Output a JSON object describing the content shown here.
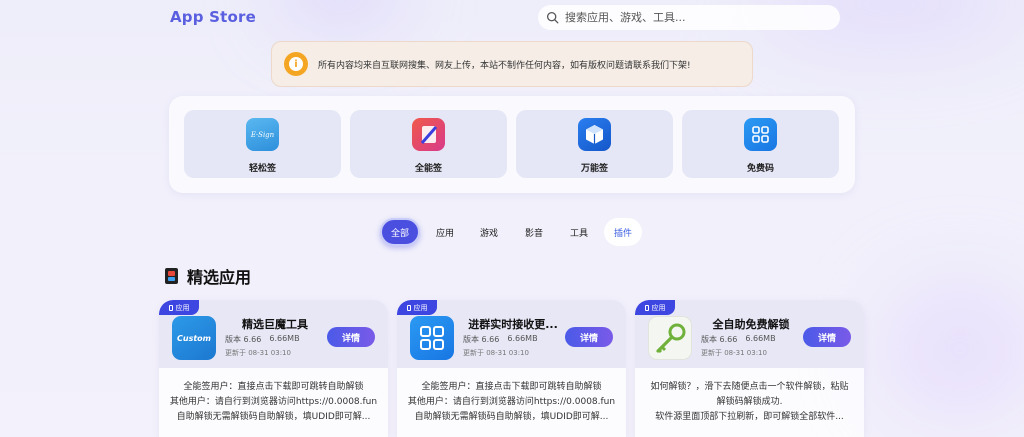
{
  "header": {
    "brand": "App Store",
    "search_placeholder": "搜索应用、游戏、工具..."
  },
  "notice": {
    "icon": "info-icon",
    "text": "所有内容均来自互联网搜集、网友上传，本站不制作任何内容，如有版权问题请联系我们下架!"
  },
  "featured": [
    {
      "label": "轻松签",
      "icon": "esign-icon",
      "icon_text": "E·Sign"
    },
    {
      "label": "全能签",
      "icon": "pen-icon"
    },
    {
      "label": "万能签",
      "icon": "box-icon"
    },
    {
      "label": "免费码",
      "icon": "grid-icon"
    }
  ],
  "tabs": [
    {
      "label": "全部",
      "active": true
    },
    {
      "label": "应用"
    },
    {
      "label": "游戏"
    },
    {
      "label": "影音"
    },
    {
      "label": "工具"
    },
    {
      "label": "插件"
    }
  ],
  "section": {
    "title": "精选应用"
  },
  "apps": [
    {
      "badge": "应用",
      "name": "精选巨魔工具",
      "version": "版本 6.66",
      "size": "6.66MB",
      "updated": "更新于 08-31 03:10",
      "button": "详情",
      "icon_text": "Custom",
      "description": "全能签用户：直接点击下载即可跳转自助解锁\n其他用户：请自行到浏览器访问https://0.0008.fun\n自助解锁无需解锁码自助解锁，填UDID即可解..."
    },
    {
      "badge": "应用",
      "name": "进群实时接收更...",
      "version": "版本 6.66",
      "size": "6.66MB",
      "updated": "更新于 08-31 03:10",
      "button": "详情",
      "description": "全能签用户：直接点击下载即可跳转自助解锁\n其他用户：请自行到浏览器访问https://0.0008.fun\n自助解锁无需解锁码自助解锁，填UDID即可解..."
    },
    {
      "badge": "应用",
      "name": "全自助免费解锁",
      "version": "版本 6.66",
      "size": "6.66MB",
      "updated": "更新于 08-31 03:10",
      "button": "详情",
      "description": "如何解锁？，滑下去随便点击一个软件解锁，粘贴\n解锁码解锁成功.\n软件源里面顶部下拉刷新，即可解锁全部软件..."
    }
  ],
  "colors": {
    "accent": "#4b4fe0",
    "brand": "#5a5fe0",
    "notice_bg": "#f5ede6",
    "warning": "#f4a623"
  }
}
